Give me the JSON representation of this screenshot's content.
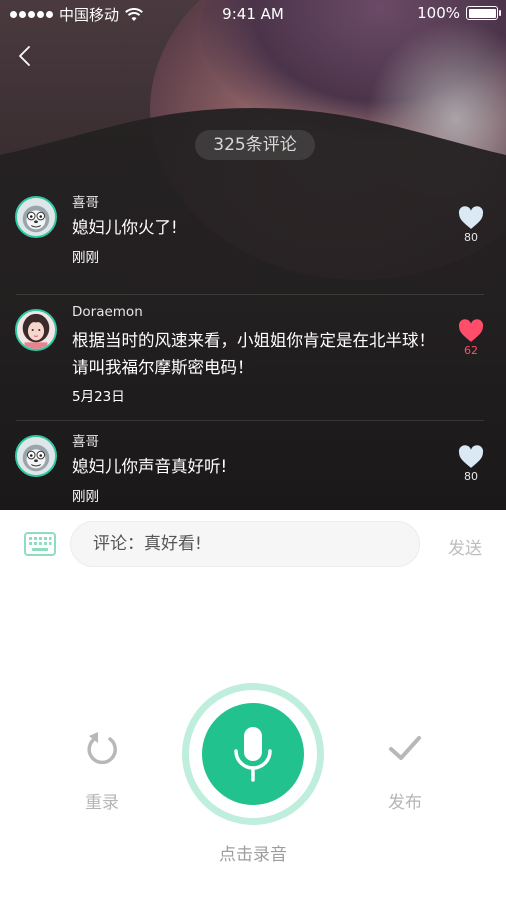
{
  "status_bar": {
    "carrier": "中国移动",
    "time": "9:41 AM",
    "battery": "100%"
  },
  "header": {
    "comment_count": "325条评论"
  },
  "comments": [
    {
      "name": "喜哥",
      "text": "媳妇儿你火了!",
      "time": "刚刚",
      "likes": "80",
      "liked": false
    },
    {
      "name": "Doraemon",
      "text": "根据当时的风速来看，小姐姐你肯定是在北半球！请叫我福尔摩斯密电码！",
      "time": "5月23日",
      "likes": "62",
      "liked": true
    },
    {
      "name": "喜哥",
      "text": "媳妇儿你声音真好听!",
      "time": "刚刚",
      "likes": "80",
      "liked": false
    }
  ],
  "input": {
    "value": "评论：真好看!",
    "send_label": "发送"
  },
  "recorder": {
    "redo_label": "重录",
    "publish_label": "发布",
    "record_label": "点击录音"
  },
  "colors": {
    "accent": "#22c28e",
    "accent_ring": "#bfeedd",
    "like_active": "#ff4d6a",
    "like_inactive": "#dbe9f5"
  },
  "icons": {
    "back": "chevron-left-icon",
    "keyboard": "keyboard-icon",
    "mic": "microphone-icon",
    "redo": "redo-icon",
    "publish": "checkmark-icon",
    "like": "heart-icon"
  }
}
